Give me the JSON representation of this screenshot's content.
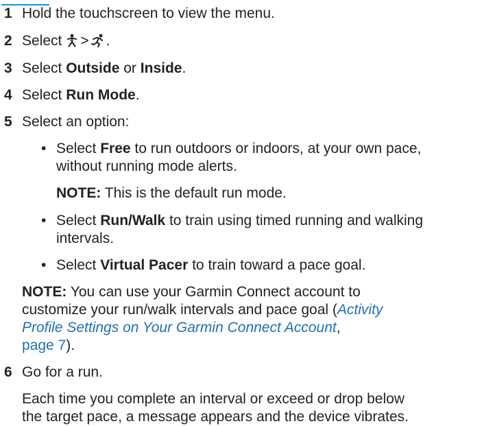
{
  "steps": [
    {
      "num": "1",
      "text": "Hold the touchscreen to view the menu."
    },
    {
      "num": "2",
      "prefix": "Select",
      "sep": ">",
      "suffix": ".",
      "icons": [
        "activity-icon",
        "run-icon"
      ]
    },
    {
      "num": "3",
      "prefix": "Select",
      "opt1": "Outside",
      "mid": "or",
      "opt2": "Inside",
      "suffix": "."
    },
    {
      "num": "4",
      "prefix": "Select",
      "opt1": "Run Mode",
      "suffix": "."
    },
    {
      "num": "5",
      "text": "Select an option:"
    },
    {
      "num": "6",
      "text": "Go for a run."
    }
  ],
  "options": [
    {
      "prefix": "Select",
      "bold": "Free",
      "rest_line1": "to run outdoors or indoors, at your own pace,",
      "rest_line2": "without running mode alerts."
    },
    {
      "prefix": "Select",
      "bold": "Run/Walk",
      "rest_line1": "to train using timed running and walking",
      "rest_line2": "intervals."
    },
    {
      "prefix": "Select",
      "bold": "Virtual Pacer",
      "rest_line1": "to train toward a pace goal."
    }
  ],
  "note1": {
    "label": "NOTE:",
    "text": "This is the default run mode."
  },
  "note2": {
    "label": "NOTE:",
    "line1": "You can use your Garmin Connect account to",
    "line2_pre": "customize your run/walk intervals and pace goal (",
    "link1a": "Activity",
    "link1b": "Profile Settings on Your Garmin Connect Account",
    "link_sep": ",",
    "link2": "page 7",
    "end": ")."
  },
  "step6_body": {
    "line1": "Each time you complete an interval or exceed or drop below",
    "line2": "the target pace, a message appears and the device vibrates."
  },
  "colors": {
    "link": "#1b6fc2",
    "heading": "#1b91cf",
    "text": "#222222"
  }
}
